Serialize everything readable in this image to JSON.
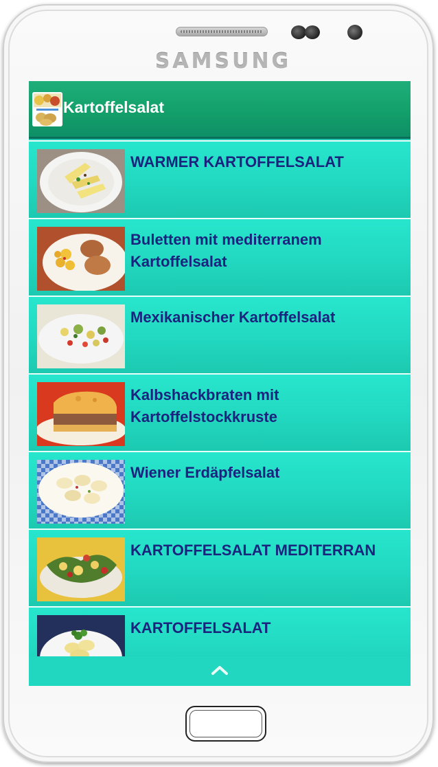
{
  "device": {
    "brand": "SAMSUNG"
  },
  "app": {
    "title": "Kartoffelsalat",
    "icon": "potato-salad-app-icon"
  },
  "recipes": [
    {
      "title": "WARMER KARTOFFELSALAT",
      "image": "warm-potato-salad-photo"
    },
    {
      "title": "Buletten mit mediterranem Kartoffelsalat",
      "image": "meatballs-potato-salad-photo"
    },
    {
      "title": "Mexikanischer Kartoffelsalat",
      "image": "mexican-potato-salad-photo"
    },
    {
      "title": "Kalbshackbraten mit Kartoffelstockkruste",
      "image": "veal-meatloaf-photo"
    },
    {
      "title": "Wiener Erdäpfelsalat",
      "image": "viennese-potato-salad-photo"
    },
    {
      "title": "KARTOFFELSALAT MEDITERRAN",
      "image": "mediterranean-potato-salad-photo"
    },
    {
      "title": "KARTOFFELSALAT",
      "image": "potato-salad-photo"
    }
  ],
  "footer": {
    "icon": "chevron-up-icon"
  },
  "colors": {
    "appbar": "#13a06a",
    "list_item": "#22d8c0",
    "item_title": "#1a237e"
  }
}
